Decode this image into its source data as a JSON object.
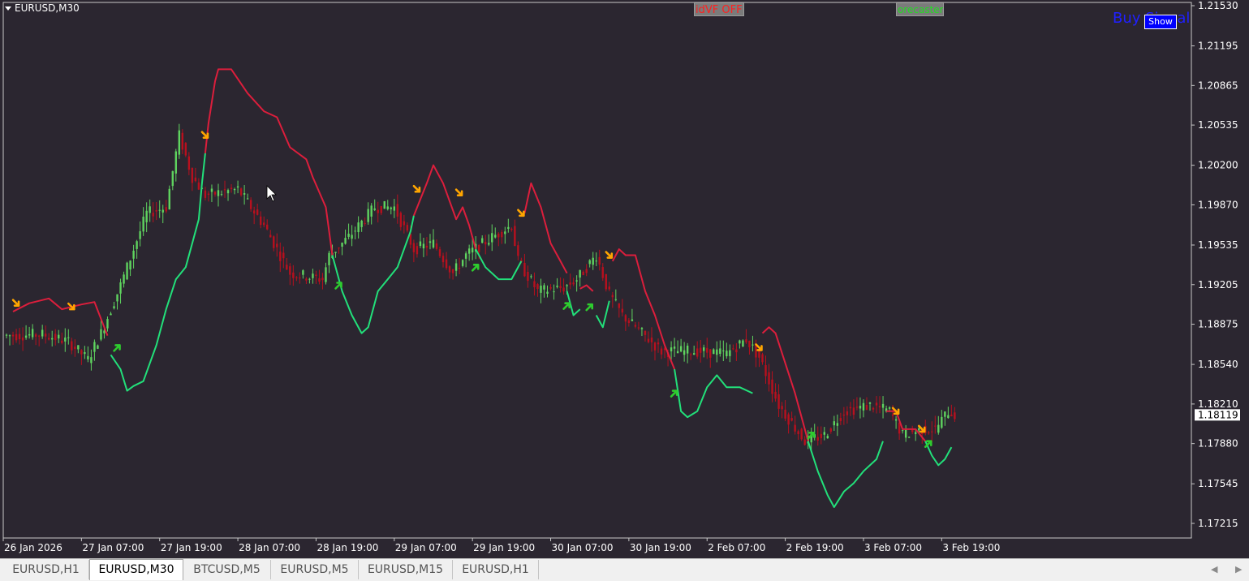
{
  "window": {
    "symbol_title": "EURUSD,M30"
  },
  "buttons": {
    "idvf": "idVF OFF",
    "forecaster": "orecaster",
    "buy_label": "Buy Signal",
    "show": "Show"
  },
  "tabs": [
    {
      "label": "EURUSD,H1",
      "active": false
    },
    {
      "label": "EURUSD,M30",
      "active": true
    },
    {
      "label": "BTCUSD,M5",
      "active": false
    },
    {
      "label": "EURUSD,M5",
      "active": false
    },
    {
      "label": "EURUSD,M15",
      "active": false
    },
    {
      "label": "EURUSD,H1",
      "active": false
    }
  ],
  "nav": {
    "left": "◀",
    "right": "▶"
  },
  "colors": {
    "background": "#2b2630",
    "bull_candle": "#5fd35f",
    "bear_candle": "#b8101e",
    "line_up": "#22e07a",
    "line_down": "#dc1e3c",
    "arrow_sell": "#ffa500",
    "arrow_buy": "#2ecc2e"
  },
  "chart_data": {
    "type": "candlestick",
    "symbol": "EURUSD",
    "timeframe": "M30",
    "current_price": "1.18119",
    "y_ticks": [
      "1.21530",
      "1.21195",
      "1.20865",
      "1.20535",
      "1.20200",
      "1.19870",
      "1.19535",
      "1.19205",
      "1.18875",
      "1.18540",
      "1.18210",
      "1.17880",
      "1.17545",
      "1.17215"
    ],
    "ylim": [
      1.1705,
      1.2165
    ],
    "x_ticks": [
      "26 Jan 2026",
      "27 Jan 07:00",
      "27 Jan 19:00",
      "28 Jan 07:00",
      "28 Jan 19:00",
      "29 Jan 07:00",
      "29 Jan 19:00",
      "30 Jan 07:00",
      "30 Jan 19:00",
      "2 Feb 07:00",
      "2 Feb 19:00",
      "3 Feb 07:00",
      "3 Feb 19:00"
    ],
    "bars_per_tick": 24,
    "close_anchors": [
      [
        0,
        1.1878
      ],
      [
        12,
        1.1879
      ],
      [
        20,
        1.1873
      ],
      [
        26,
        1.1858
      ],
      [
        30,
        1.188
      ],
      [
        36,
        1.192
      ],
      [
        44,
        1.198
      ],
      [
        50,
        1.1985
      ],
      [
        54,
        1.2045
      ],
      [
        58,
        1.201
      ],
      [
        62,
        1.1995
      ],
      [
        72,
        1.2
      ],
      [
        80,
        1.197
      ],
      [
        88,
        1.193
      ],
      [
        98,
        1.1925
      ],
      [
        100,
        1.1945
      ],
      [
        106,
        1.196
      ],
      [
        114,
        1.1985
      ],
      [
        120,
        1.1985
      ],
      [
        126,
        1.195
      ],
      [
        132,
        1.1955
      ],
      [
        138,
        1.193
      ],
      [
        142,
        1.1945
      ],
      [
        150,
        1.196
      ],
      [
        156,
        1.197
      ],
      [
        158,
        1.194
      ],
      [
        164,
        1.1915
      ],
      [
        172,
        1.1918
      ],
      [
        176,
        1.1925
      ],
      [
        182,
        1.1945
      ],
      [
        186,
        1.1912
      ],
      [
        190,
        1.1895
      ],
      [
        196,
        1.188
      ],
      [
        202,
        1.1865
      ],
      [
        206,
        1.1865
      ],
      [
        214,
        1.1865
      ],
      [
        222,
        1.1863
      ],
      [
        228,
        1.1875
      ],
      [
        232,
        1.186
      ],
      [
        238,
        1.182
      ],
      [
        246,
        1.179
      ],
      [
        252,
        1.1795
      ],
      [
        258,
        1.1815
      ],
      [
        266,
        1.182
      ],
      [
        272,
        1.1815
      ],
      [
        276,
        1.1795
      ],
      [
        282,
        1.18
      ],
      [
        286,
        1.18
      ],
      [
        290,
        1.1815
      ],
      [
        292,
        1.1812
      ]
    ],
    "indicator_segments": [
      {
        "trend": "down",
        "points": [
          [
            3,
            1.1898
          ],
          [
            8,
            1.1905
          ],
          [
            14,
            1.1909
          ],
          [
            18,
            1.19
          ],
          [
            24,
            1.1904
          ],
          [
            28,
            1.1906
          ],
          [
            32,
            1.1878
          ]
        ]
      },
      {
        "trend": "up",
        "points": [
          [
            33,
            1.1862
          ],
          [
            36,
            1.185
          ],
          [
            38,
            1.1832
          ],
          [
            40,
            1.1836
          ],
          [
            43,
            1.184
          ],
          [
            47,
            1.187
          ],
          [
            50,
            1.19
          ],
          [
            53,
            1.1925
          ],
          [
            56,
            1.1935
          ],
          [
            58,
            1.1955
          ],
          [
            60,
            1.1975
          ],
          [
            61,
            1.2005
          ],
          [
            62,
            1.203
          ]
        ]
      },
      {
        "trend": "down",
        "points": [
          [
            62,
            1.203
          ],
          [
            63,
            1.2055
          ],
          [
            65,
            1.209
          ],
          [
            66,
            1.21
          ],
          [
            70,
            1.21
          ],
          [
            75,
            1.208
          ],
          [
            80,
            1.2065
          ],
          [
            84,
            1.206
          ],
          [
            88,
            1.2035
          ],
          [
            93,
            1.2025
          ],
          [
            95,
            1.201
          ],
          [
            99,
            1.1985
          ],
          [
            101,
            1.1945
          ]
        ]
      },
      {
        "trend": "up",
        "points": [
          [
            101,
            1.1945
          ],
          [
            104,
            1.1915
          ],
          [
            107,
            1.1895
          ],
          [
            110,
            1.188
          ],
          [
            112,
            1.1885
          ],
          [
            115,
            1.1915
          ],
          [
            118,
            1.1925
          ],
          [
            121,
            1.1935
          ],
          [
            125,
            1.1965
          ],
          [
            126,
            1.1978
          ]
        ]
      },
      {
        "trend": "down",
        "points": [
          [
            126,
            1.1978
          ],
          [
            130,
            1.2005
          ],
          [
            132,
            1.202
          ],
          [
            135,
            1.2005
          ],
          [
            139,
            1.1975
          ],
          [
            141,
            1.1985
          ],
          [
            143,
            1.197
          ],
          [
            145,
            1.195
          ]
        ]
      },
      {
        "trend": "up",
        "points": [
          [
            145,
            1.195
          ],
          [
            148,
            1.1935
          ],
          [
            152,
            1.1925
          ],
          [
            156,
            1.1925
          ],
          [
            159,
            1.194
          ]
        ]
      },
      {
        "trend": "down",
        "points": [
          [
            160,
            1.198
          ],
          [
            162,
            1.2005
          ],
          [
            165,
            1.1985
          ],
          [
            168,
            1.1955
          ],
          [
            171,
            1.194
          ],
          [
            173,
            1.193
          ]
        ]
      },
      {
        "trend": "up",
        "points": [
          [
            173,
            1.1915
          ],
          [
            175,
            1.1895
          ],
          [
            177,
            1.19
          ]
        ]
      },
      {
        "trend": "down",
        "points": [
          [
            177,
            1.1917
          ],
          [
            179,
            1.192
          ],
          [
            181,
            1.1915
          ]
        ]
      },
      {
        "trend": "up",
        "points": [
          [
            182,
            1.1895
          ],
          [
            184,
            1.1885
          ],
          [
            186,
            1.1907
          ]
        ]
      },
      {
        "trend": "down",
        "points": [
          [
            187,
            1.194
          ],
          [
            189,
            1.195
          ],
          [
            191,
            1.1945
          ],
          [
            194,
            1.1945
          ],
          [
            197,
            1.1915
          ],
          [
            200,
            1.1895
          ],
          [
            203,
            1.187
          ],
          [
            206,
            1.185
          ]
        ]
      },
      {
        "trend": "up",
        "points": [
          [
            206,
            1.185
          ],
          [
            208,
            1.1815
          ],
          [
            210,
            1.181
          ],
          [
            213,
            1.1815
          ],
          [
            216,
            1.1835
          ],
          [
            219,
            1.1845
          ],
          [
            222,
            1.1835
          ],
          [
            226,
            1.1835
          ],
          [
            230,
            1.183
          ]
        ]
      },
      {
        "trend": "down",
        "points": [
          [
            233,
            1.188
          ],
          [
            235,
            1.1885
          ],
          [
            237,
            1.188
          ],
          [
            240,
            1.1855
          ],
          [
            243,
            1.183
          ],
          [
            246,
            1.18
          ],
          [
            247,
            1.179
          ]
        ]
      },
      {
        "trend": "up",
        "points": [
          [
            247,
            1.179
          ],
          [
            250,
            1.1765
          ],
          [
            253,
            1.1745
          ],
          [
            255,
            1.1735
          ],
          [
            258,
            1.1748
          ],
          [
            261,
            1.1755
          ],
          [
            264,
            1.1765
          ],
          [
            268,
            1.1775
          ],
          [
            270,
            1.179
          ]
        ]
      },
      {
        "trend": "down",
        "points": [
          [
            271,
            1.1815
          ],
          [
            274,
            1.1815
          ],
          [
            276,
            1.18
          ],
          [
            280,
            1.18
          ],
          [
            283,
            1.179
          ]
        ]
      },
      {
        "trend": "up",
        "points": [
          [
            283,
            1.179
          ],
          [
            285,
            1.1778
          ],
          [
            287,
            1.177
          ],
          [
            289,
            1.1775
          ],
          [
            291,
            1.1785
          ]
        ]
      }
    ],
    "sell_arrows": [
      [
        4,
        1.1905
      ],
      [
        21,
        1.1902
      ],
      [
        62,
        1.2045
      ],
      [
        127,
        1.2
      ],
      [
        140,
        1.1997
      ],
      [
        159,
        1.198
      ],
      [
        186,
        1.1945
      ],
      [
        232,
        1.1868
      ],
      [
        274,
        1.1815
      ],
      [
        282,
        1.18
      ]
    ],
    "buy_arrows": [
      [
        35,
        1.1868
      ],
      [
        103,
        1.192
      ],
      [
        145,
        1.1935
      ],
      [
        173,
        1.1903
      ],
      [
        180,
        1.1902
      ],
      [
        206,
        1.183
      ],
      [
        248,
        1.1795
      ],
      [
        284,
        1.1788
      ]
    ]
  }
}
